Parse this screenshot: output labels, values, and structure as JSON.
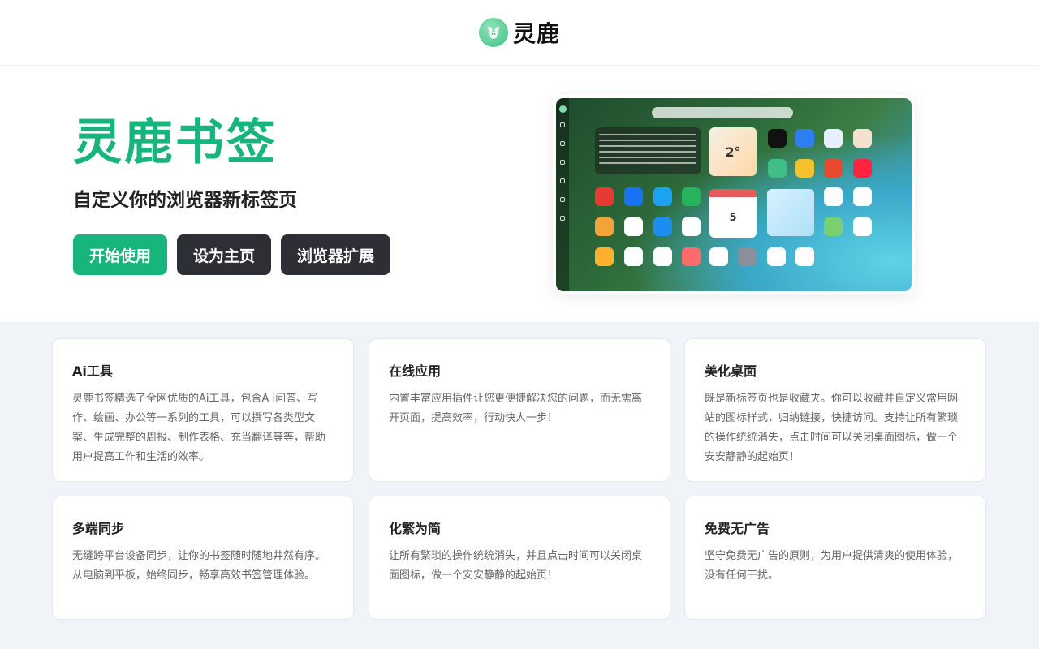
{
  "brand": {
    "name": "灵鹿"
  },
  "hero": {
    "title": "灵鹿书签",
    "subtitle": "自定义你的浏览器新标签页",
    "buttons": [
      "开始使用",
      "设为主页",
      "浏览器扩展"
    ]
  },
  "preview": {
    "weather": "2°",
    "calendar_day": "5"
  },
  "features": [
    {
      "title": "Ai工具",
      "desc": "灵鹿书签精选了全网优质的Ai工具，包含A i问答、写作、绘画、办公等一系列的工具，可以撰写各类型文案、生成完整的周报、制作表格、充当翻译等等，帮助用户提高工作和生活的效率。"
    },
    {
      "title": "在线应用",
      "desc": "内置丰富应用插件让您更便捷解决您的问题，而无需离开页面，提高效率，行动快人一步！"
    },
    {
      "title": "美化桌面",
      "desc": "既是新标签页也是收藏夹。你可以收藏并自定义常用网站的图标样式，归纳链接，快捷访问。支持让所有繁琐的操作统统消失，点击时间可以关闭桌面图标，做一个安安静静的起始页！"
    },
    {
      "title": "多端同步",
      "desc": "无缝跨平台设备同步，让你的书签随时随地井然有序。从电脑到平板，始终同步，畅享高效书签管理体验。"
    },
    {
      "title": "化繁为简",
      "desc": "让所有繁琐的操作统统消失，并且点击时间可以关闭桌面图标，做一个安安静静的起始页！"
    },
    {
      "title": "免费无广告",
      "desc": "坚守免费无广告的原则，为用户提供清爽的使用体验，没有任何干扰。"
    }
  ],
  "colors": {
    "brand_green": "#17b47b",
    "dark_button": "#2d2f34",
    "section_bg": "#f0f3f8"
  }
}
